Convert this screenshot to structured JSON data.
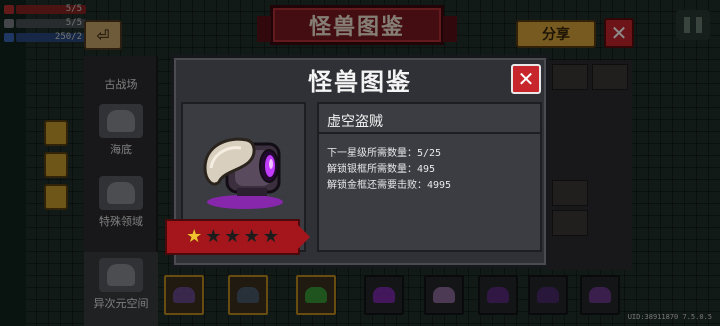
{
  "hud": {
    "hp": "5/5",
    "armor": "5/5",
    "energy": "250/2"
  },
  "background": {
    "banner_title": "怪兽图鉴",
    "share_label": "分享",
    "close_label": "✕",
    "back_label": "⏎",
    "categories": [
      {
        "label": "古战场"
      },
      {
        "label": "海底"
      },
      {
        "label": "特殊领域"
      },
      {
        "label": "异次元空间"
      }
    ],
    "uid": "UID:38911870 7.5.0.5"
  },
  "modal": {
    "title": "怪兽图鉴",
    "close_label": "✕",
    "monster_name": "虚空盗贼",
    "line1_label": "下一星级所需数量：",
    "line1_value": "5/25",
    "line2_label": "解锁银框所需数量：",
    "line2_value": "495",
    "line3_label": "解锁金框还需要击败：",
    "line3_value": "4995",
    "stars_filled": 1,
    "stars_total": 5,
    "stars": [
      "★",
      "★",
      "★",
      "★",
      "★"
    ]
  },
  "colors": {
    "modal_bg": "#2f3136",
    "close_red": "#c7262c",
    "ribbon_red": "#a4161c",
    "star_gold": "#f2c230",
    "monster_purple": "#c13cff"
  },
  "icons": [
    "close-icon",
    "share-icon",
    "back-icon",
    "pause-icon",
    "star-icon",
    "void-thief-icon"
  ]
}
